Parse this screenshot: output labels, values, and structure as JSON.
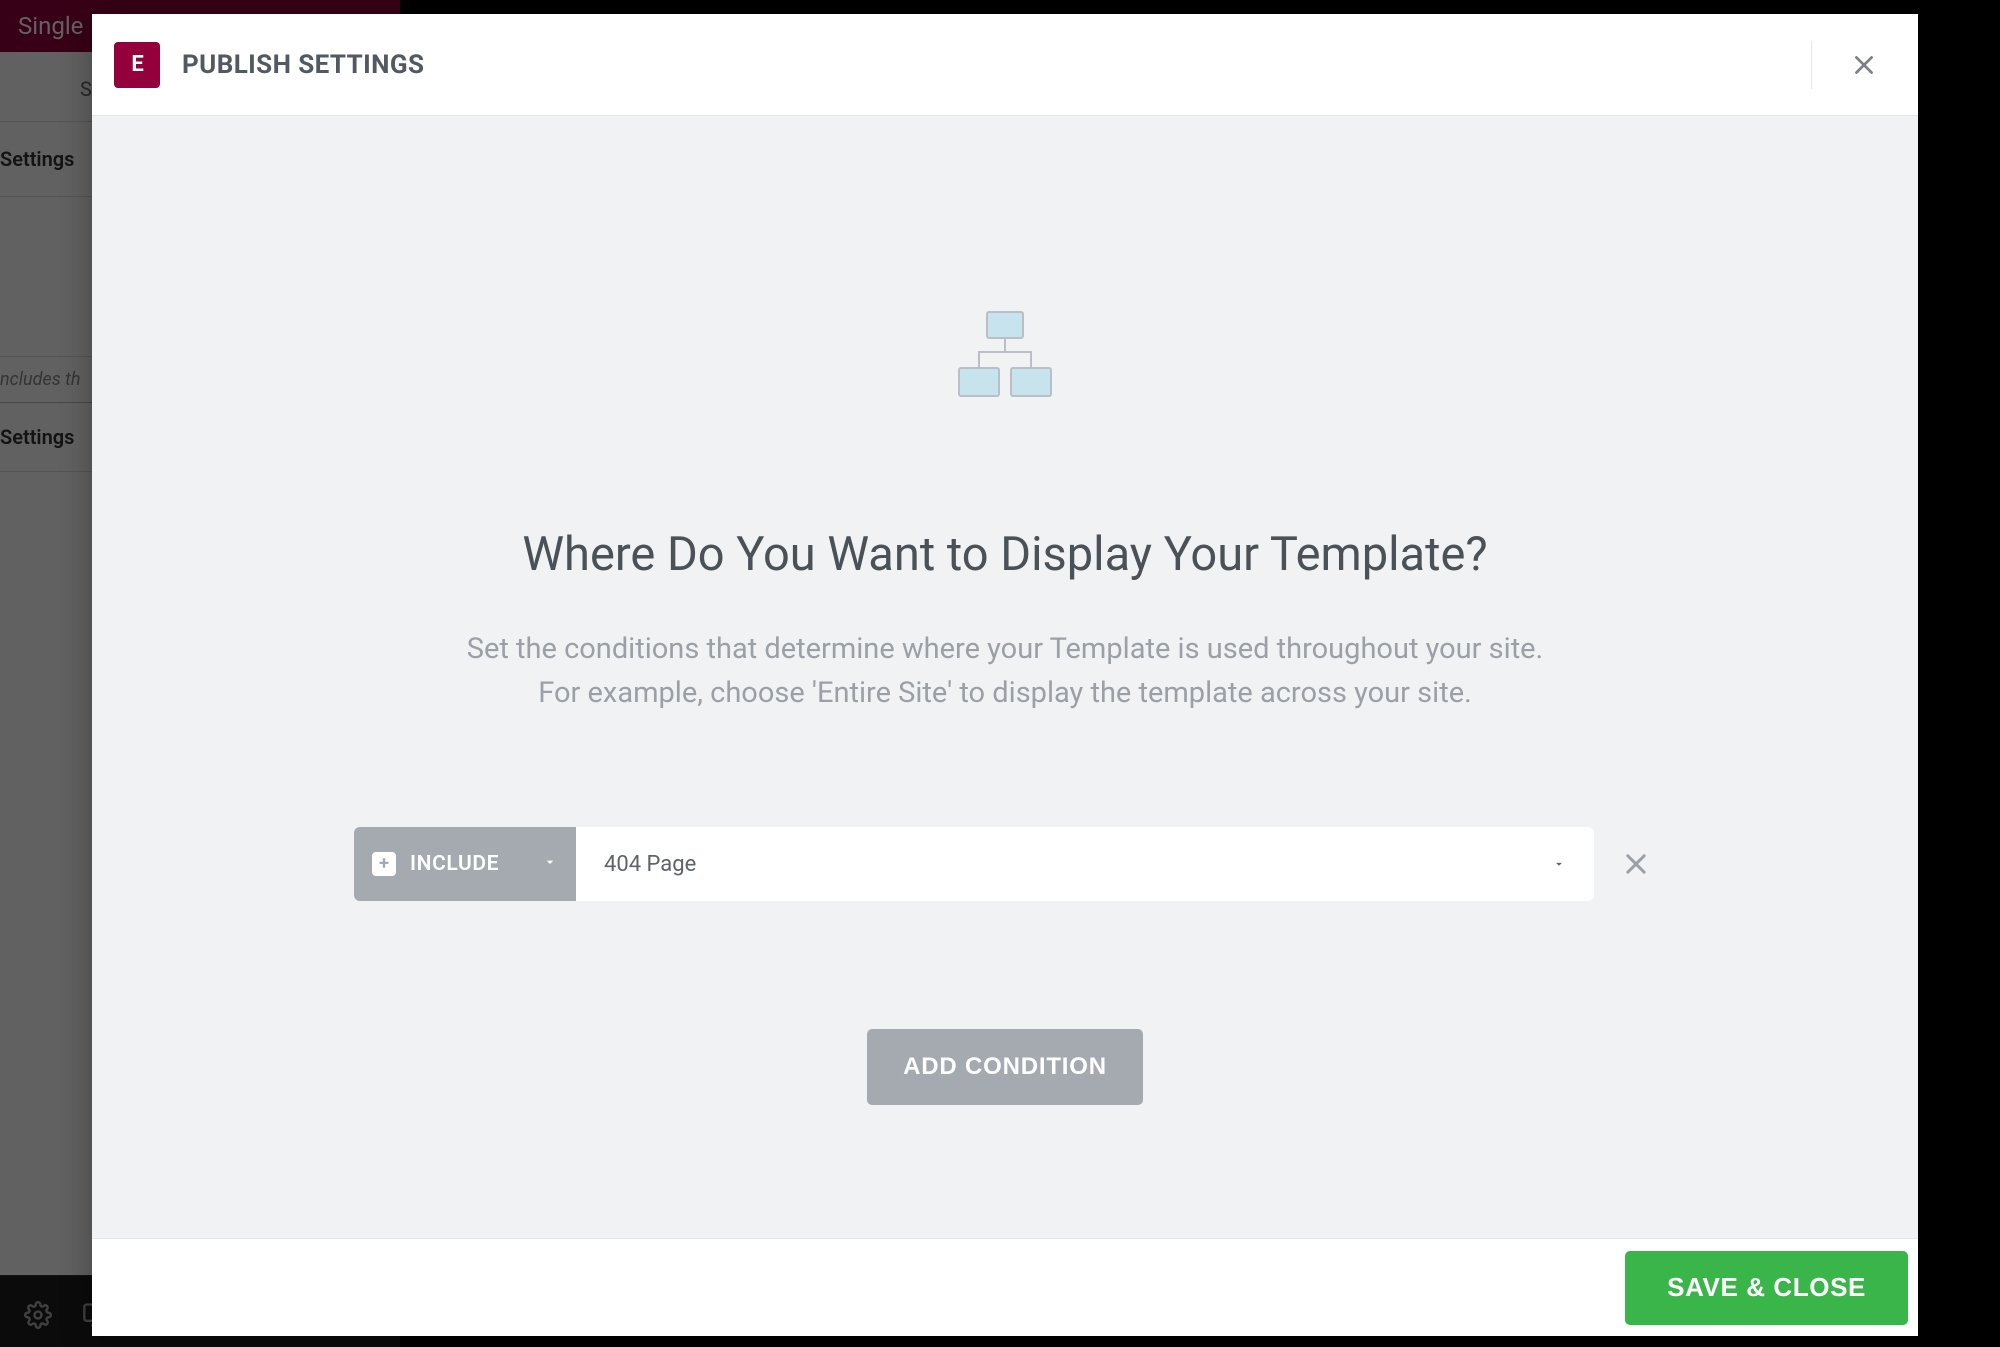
{
  "background": {
    "header_text": "Single",
    "subtab": "S",
    "section1": "Settings",
    "note": "ncludes th",
    "section2": "Settings"
  },
  "modal": {
    "logo_text": "E",
    "title": "PUBLISH SETTINGS",
    "hero_title": "Where Do You Want to Display Your Template?",
    "hero_desc_line1": "Set the conditions that determine where your Template is used throughout your site.",
    "hero_desc_line2": "For example, choose 'Entire Site' to display the template across your site.",
    "condition": {
      "mode_label": "INCLUDE",
      "target_value": "404 Page"
    },
    "add_condition_label": "ADD CONDITION",
    "save_close_label": "SAVE & CLOSE"
  }
}
